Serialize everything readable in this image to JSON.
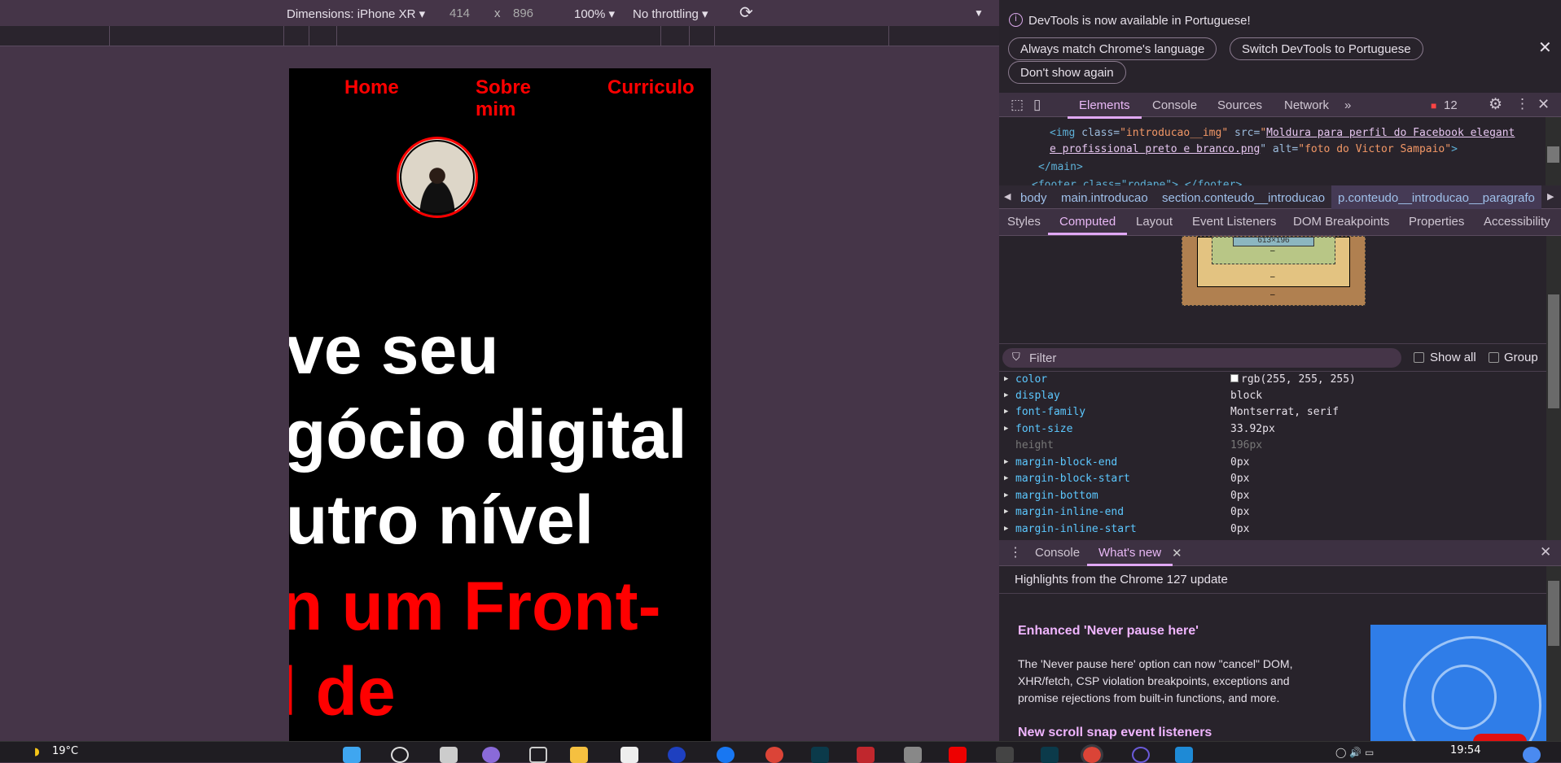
{
  "device_toolbar": {
    "dimensions_label": "Dimensions: iPhone XR",
    "width": "414",
    "times": "x",
    "height": "896",
    "zoom": "100%",
    "throttling": "No throttling"
  },
  "page": {
    "nav": [
      "Home",
      "Sobre mim",
      "Curriculo"
    ],
    "avatar_alt": "foto do Victor Sampaio",
    "headline_white": [
      "ve seu",
      "gócio digital",
      "utro nível"
    ],
    "headline_red": [
      "n um Front-",
      "l de"
    ],
    "colors": {
      "background": "#000000",
      "accent": "#ff0000",
      "text": "#ffffff"
    }
  },
  "devtools": {
    "notice": {
      "text": "DevTools is now available in Portuguese!",
      "buttons": [
        "Always match Chrome's language",
        "Switch DevTools to Portuguese",
        "Don't show again"
      ]
    },
    "tabs": [
      "Elements",
      "Console",
      "Sources",
      "Network"
    ],
    "issues_count": "12",
    "code": {
      "line1_tag": "<img ",
      "line1_attr1": "class=",
      "line1_val1": "\"introducao__img\"",
      "line1_attr2": " src=",
      "line1_val2a": "\"",
      "line1_link1": "Moldura para perfil do Facebook elegant",
      "line2_link": "e profissional preto e branco.png",
      "line2_rest_attr": "\" alt=",
      "line2_val": "\"foto do Victor Sampaio\"",
      "line2_end": ">",
      "line3": "</main>",
      "line4": "<footer class=\"rodape\">…</footer>"
    },
    "breadcrumbs": [
      "body",
      "main.introducao",
      "section.conteudo__introducao",
      "p.conteudo__introducao__paragrafo"
    ],
    "subtabs": [
      "Styles",
      "Computed",
      "Layout",
      "Event Listeners",
      "DOM Breakpoints",
      "Properties",
      "Accessibility"
    ],
    "box_model": {
      "content": "613×196",
      "dash": "–"
    },
    "filter": {
      "placeholder": "Filter",
      "show_all": "Show all",
      "group": "Group"
    },
    "properties": [
      {
        "name": "color",
        "value": "rgb(255, 255, 255)"
      },
      {
        "name": "display",
        "value": "block"
      },
      {
        "name": "font-family",
        "value": "Montserrat, serif"
      },
      {
        "name": "font-size",
        "value": "33.92px"
      },
      {
        "name": "height",
        "value": "196px"
      },
      {
        "name": "margin-block-end",
        "value": "0px"
      },
      {
        "name": "margin-block-start",
        "value": "0px"
      },
      {
        "name": "margin-bottom",
        "value": "0px"
      },
      {
        "name": "margin-inline-end",
        "value": "0px"
      },
      {
        "name": "margin-inline-start",
        "value": "0px"
      }
    ],
    "drawer": {
      "tabs": [
        "Console",
        "What's new"
      ],
      "highlights": "Highlights from the Chrome 127 update",
      "h1": "Enhanced 'Never pause here'",
      "p1": "The 'Never pause here' option can now \"cancel\" DOM, XHR/fetch, CSP violation breakpoints, exceptions and promise rejections from built-in functions, and more.",
      "h2": "New scroll snap event listeners"
    }
  },
  "taskbar": {
    "weather": "19°C",
    "time": "19:54"
  }
}
